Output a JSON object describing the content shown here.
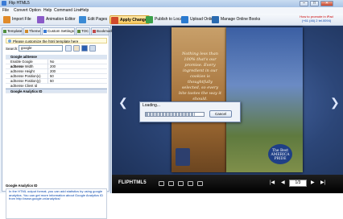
{
  "window": {
    "title": "Flip HTML5",
    "min": "–",
    "max": "□",
    "close": "✕"
  },
  "menu": [
    "File",
    "Convert",
    "Option",
    "Help",
    "Command Line",
    "Help"
  ],
  "toolbar": {
    "items": [
      {
        "label": "Import File",
        "icon": "import-icon",
        "color": "#e08a2a"
      },
      {
        "label": "Animation Editor",
        "icon": "animation-icon",
        "color": "#8a5ac8"
      },
      {
        "label": "Edit Pages",
        "icon": "edit-pages-icon",
        "color": "#3a8ad5"
      },
      {
        "label": "Apply Change",
        "icon": "apply-change-icon",
        "color": "#d04a2a"
      },
      {
        "label": "Publish to Local",
        "icon": "publish-icon",
        "color": "#3aa04a"
      },
      {
        "label": "Upload Online",
        "icon": "upload-icon",
        "color": "#2a7ad0"
      },
      {
        "label": "Manage Online Books",
        "icon": "manage-books-icon",
        "color": "#2a6ab0"
      }
    ],
    "promo_line1": "How to promote in iPad",
    "promo_line2": "(+61 (46) 2 tel.0094)"
  },
  "tabs": [
    {
      "label": "Template"
    },
    {
      "label": "Theme"
    },
    {
      "label": "Custom Settings",
      "selected": true
    },
    {
      "label": "TOC"
    },
    {
      "label": "Bookmark"
    }
  ],
  "settings": {
    "hint": "Please customize the html template here",
    "search_label": "Search:",
    "search_value": "google",
    "rows": [
      {
        "key": "Google adSense",
        "value": "",
        "type": "hdr"
      },
      {
        "key": "Enable Google adSense",
        "value": "No"
      },
      {
        "key": "adSense Width",
        "value": "200"
      },
      {
        "key": "adSense Height",
        "value": "200"
      },
      {
        "key": "adSense Position(x)",
        "value": "50"
      },
      {
        "key": "adSense Position(y)",
        "value": "50"
      },
      {
        "key": "adSense Client Id",
        "value": ""
      },
      {
        "key": "Google Analytics ID",
        "value": "",
        "type": "hdr2"
      }
    ],
    "desc_title": "Google Analytics ID",
    "desc_text": "In the HTML output format, you can add statistics by using google analytics. You can get more information about Google Analytics ID from http://www.google.cn/analytics/"
  },
  "book": {
    "poem": "Nothing less than 100% that's our promise. Every ingredient in our cookies is thoughtfully selected, so every bite tastes the way it should.",
    "badge": "The Best AMERICA PRIDE"
  },
  "dialog": {
    "title": "Loading...",
    "cancel": "Cancel",
    "progress": 0.85
  },
  "viewer": {
    "logo": "FLIPHTML5",
    "page": "1/3",
    "nav_prev": "◀",
    "nav_first": "|◀",
    "nav_next": "▶",
    "nav_last": "▶|",
    "prev_arrow": "❮",
    "next_arrow": "❯"
  }
}
